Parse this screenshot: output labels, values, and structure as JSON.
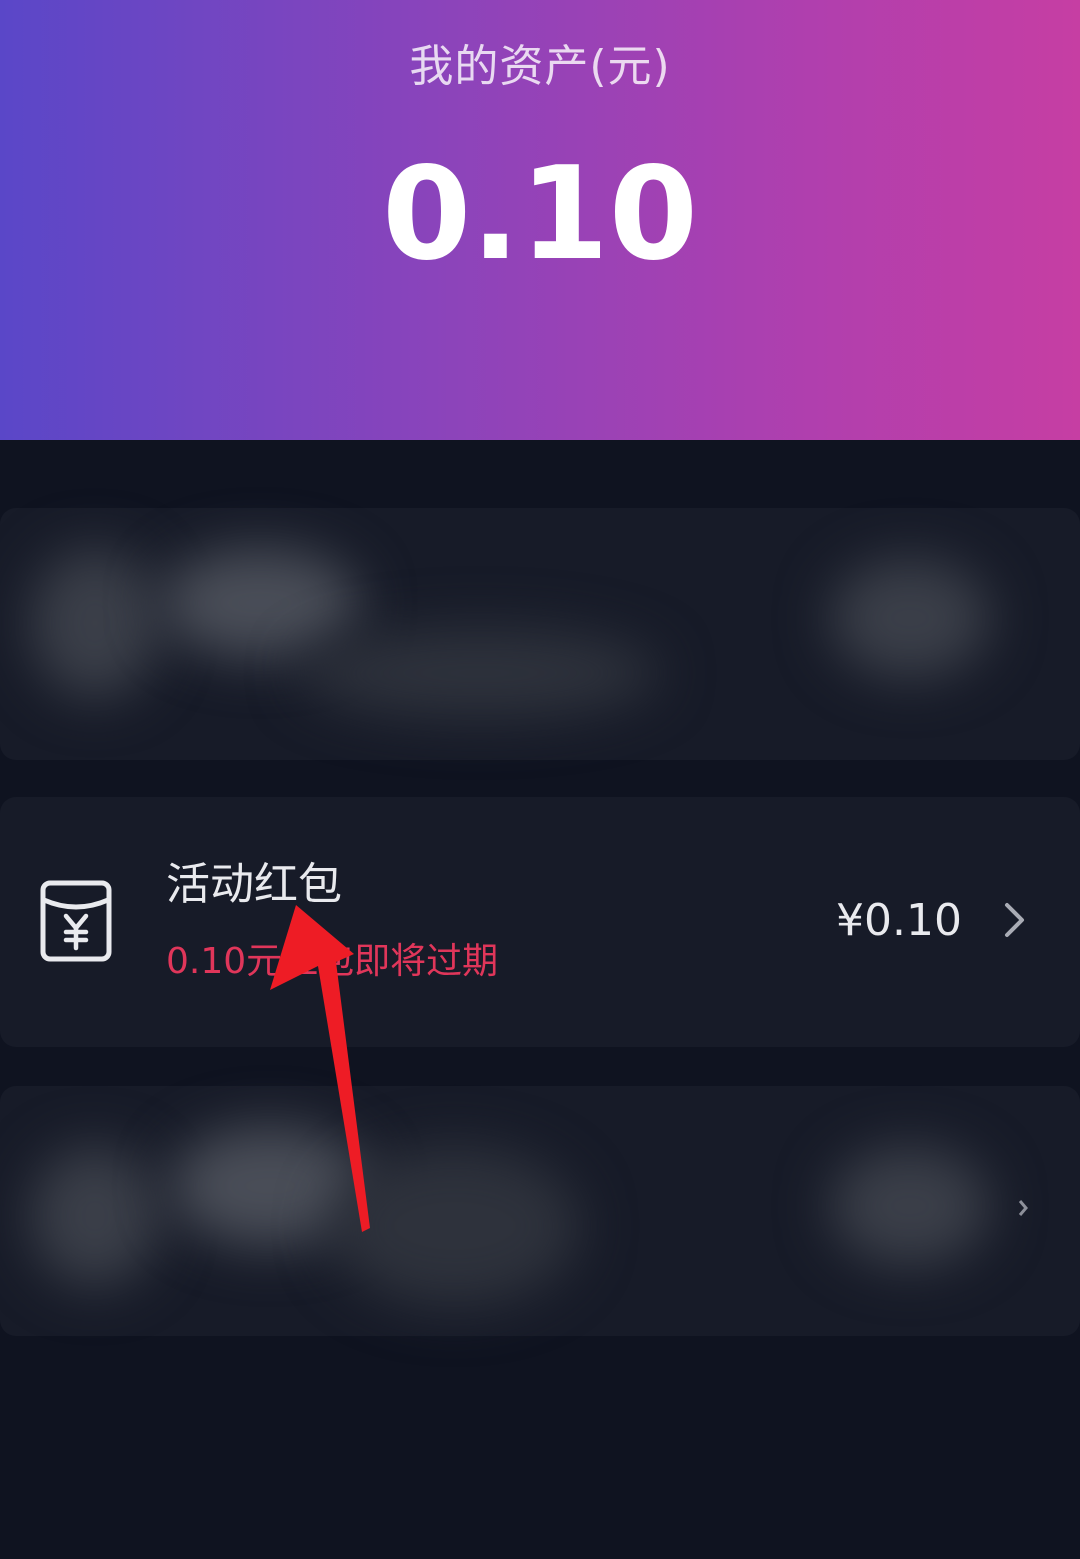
{
  "header": {
    "title": "我的资产(元)",
    "amount": "0.10"
  },
  "activity_red_packet": {
    "title": "活动红包",
    "subtitle": "0.10元红包即将过期",
    "value": "¥0.10",
    "icon": "red-packet-icon"
  },
  "colors": {
    "gradient_start": "#5a47c8",
    "gradient_end": "#c63ea3",
    "background": "#0f1320",
    "card": "#171b28",
    "warning_text": "#e0365a",
    "arrow": "#ee1c25"
  }
}
